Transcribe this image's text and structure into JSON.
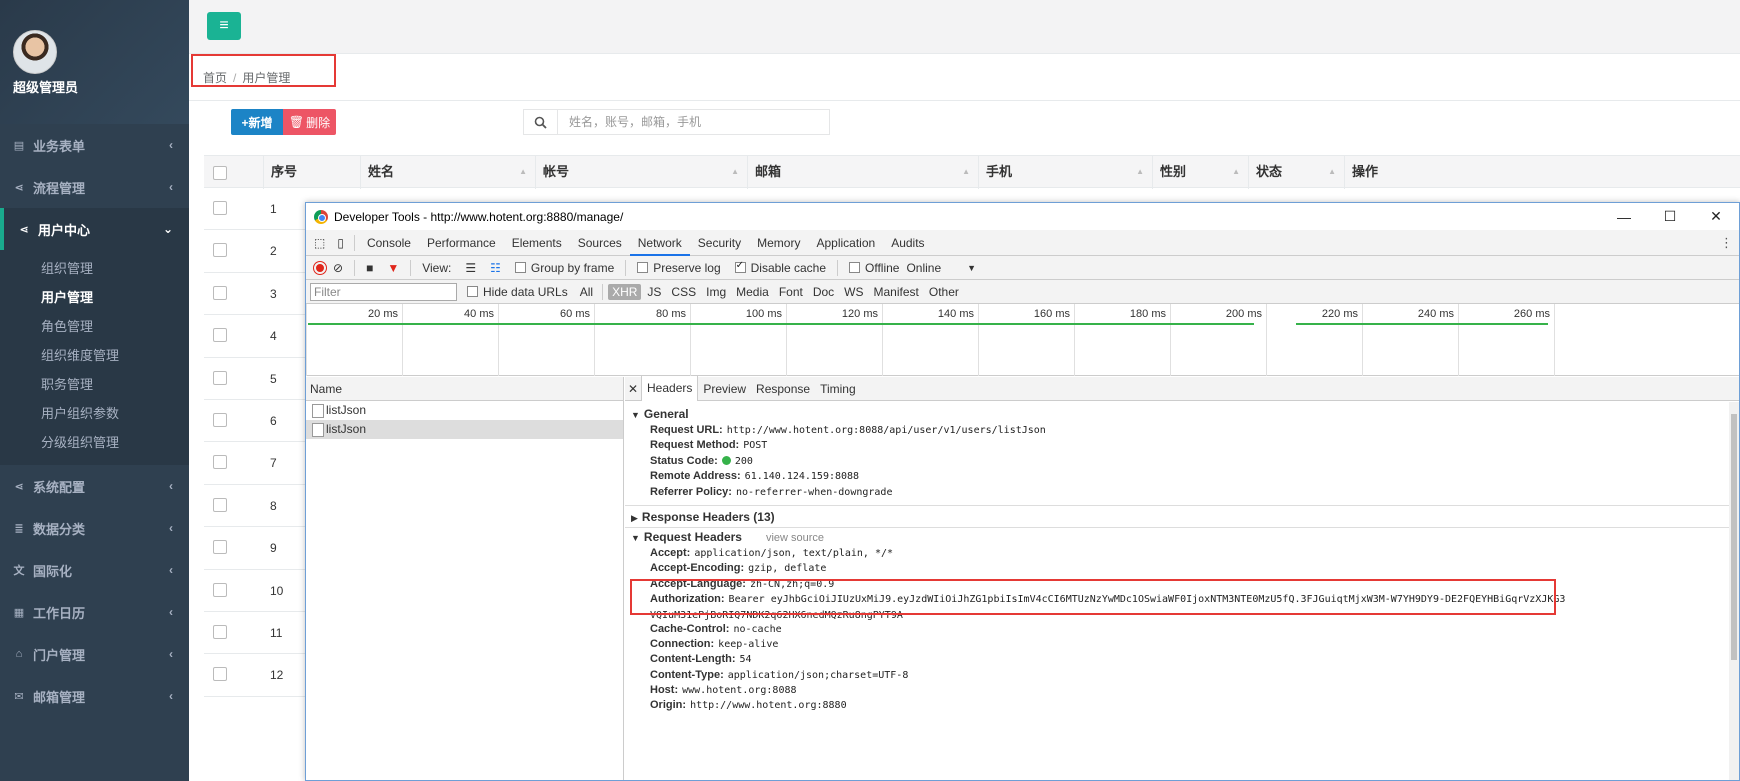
{
  "sidebar": {
    "user_name": "超级管理员",
    "menu": [
      {
        "label": "业务表单",
        "icon": "table-icon"
      },
      {
        "label": "流程管理",
        "icon": "share-icon"
      },
      {
        "label": "用户中心",
        "icon": "share-icon"
      },
      {
        "label": "系统配置",
        "icon": "share-icon"
      },
      {
        "label": "数据分类",
        "icon": "database-icon"
      },
      {
        "label": "国际化",
        "icon": "translate-icon"
      },
      {
        "label": "工作日历",
        "icon": "calendar-icon"
      },
      {
        "label": "门户管理",
        "icon": "home-icon"
      },
      {
        "label": "邮箱管理",
        "icon": "envelope-icon"
      }
    ],
    "submenu": [
      "组织管理",
      "用户管理",
      "角色管理",
      "组织维度管理",
      "职务管理",
      "用户组织参数",
      "分级组织管理"
    ],
    "active_color": "#19aa8d"
  },
  "breadcrumb": {
    "home": "首页",
    "sep": "/",
    "current": "用户管理"
  },
  "toolbar": {
    "add_label": "+新增",
    "delete_label": "删除",
    "search_placeholder": "姓名，账号，邮箱，手机"
  },
  "grid": {
    "columns": [
      "序号",
      "姓名",
      "帐号",
      "邮箱",
      "手机",
      "性别",
      "状态",
      "操作"
    ],
    "rows": [
      "1",
      "2",
      "3",
      "4",
      "5",
      "6",
      "7",
      "8",
      "9",
      "10",
      "11",
      "12"
    ]
  },
  "devtools": {
    "title": "Developer Tools - http://www.hotent.org:8880/manage/",
    "tabs": [
      "Console",
      "Performance",
      "Elements",
      "Sources",
      "Network",
      "Security",
      "Memory",
      "Application",
      "Audits"
    ],
    "selected_tab": "Network",
    "toolbar": {
      "view": "View:",
      "group_by_frame": "Group by frame",
      "preserve_log": "Preserve log",
      "disable_cache": "Disable cache",
      "offline": "Offline",
      "online": "Online"
    },
    "filter": {
      "placeholder": "Filter",
      "hide_data_urls": "Hide data URLs",
      "types": [
        "All",
        "XHR",
        "JS",
        "CSS",
        "Img",
        "Media",
        "Font",
        "Doc",
        "WS",
        "Manifest",
        "Other"
      ],
      "selected_type": "XHR"
    },
    "timeline_ticks": [
      "20 ms",
      "40 ms",
      "60 ms",
      "80 ms",
      "100 ms",
      "120 ms",
      "140 ms",
      "160 ms",
      "180 ms",
      "200 ms",
      "220 ms",
      "240 ms",
      "260 ms"
    ],
    "name_header": "Name",
    "requests": [
      "listJson",
      "listJson"
    ],
    "detail_tabs": [
      "Headers",
      "Preview",
      "Response",
      "Timing"
    ],
    "general": {
      "title": "General",
      "items": [
        {
          "k": "Request URL:",
          "v": "http://www.hotent.org:8088/api/user/v1/users/listJson"
        },
        {
          "k": "Request Method:",
          "v": "POST"
        },
        {
          "k": "Status Code:",
          "v": "200"
        },
        {
          "k": "Remote Address:",
          "v": "61.140.124.159:8088"
        },
        {
          "k": "Referrer Policy:",
          "v": "no-referrer-when-downgrade"
        }
      ]
    },
    "response_headers": "Response Headers (13)",
    "request_headers": {
      "title": "Request Headers",
      "view_source": "view source",
      "before": [
        {
          "k": "Accept:",
          "v": "application/json, text/plain, */*"
        },
        {
          "k": "Accept-Encoding:",
          "v": "gzip, deflate"
        },
        {
          "k": "Accept-Language:",
          "v": "zh-CN,zh;q=0.9"
        }
      ],
      "auth_key": "Authorization:",
      "auth_line1": "Bearer eyJhbGciOiJIUzUxMiJ9.eyJzdWIiOiJhZG1pbiIsImV4cCI6MTUzNzYwMDc1OSwiaWF0IjoxNTM3NTE0MzU5fQ.3FJGuiqtMjxW3M-W7YH9DY9-DE2FQEYHBiGqrVzXJKG3",
      "auth_line2": "VQIuM31ePjBoRIQ7NDK2q62HX6nedMQzRu8ngPYT9A",
      "after": [
        {
          "k": "Cache-Control:",
          "v": "no-cache"
        },
        {
          "k": "Connection:",
          "v": "keep-alive"
        },
        {
          "k": "Content-Length:",
          "v": "54"
        },
        {
          "k": "Content-Type:",
          "v": "application/json;charset=UTF-8"
        },
        {
          "k": "Host:",
          "v": "www.hotent.org:8088"
        },
        {
          "k": "Origin:",
          "v": "http://www.hotent.org:8880"
        }
      ]
    }
  }
}
